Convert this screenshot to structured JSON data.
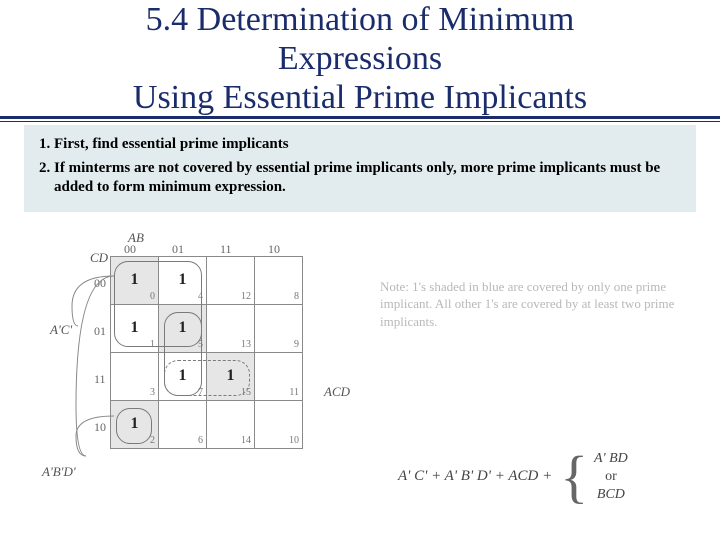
{
  "slide": {
    "title_l1": "5.4 Determination of Minimum",
    "title_l2": "Expressions",
    "title_l3": "Using Essential Prime Implicants"
  },
  "steps": {
    "s1": "First, find essential prime implicants",
    "s2": "If minterms are not covered by essential prime implicants only, more prime implicants must be added to form minimum expression."
  },
  "kmap": {
    "var_cols": "AB",
    "var_rows": "CD",
    "col_headers": [
      "00",
      "01",
      "11",
      "10"
    ],
    "row_headers": [
      "00",
      "01",
      "11",
      "10"
    ],
    "cells": [
      [
        {
          "v": "1",
          "n": "0"
        },
        {
          "v": "1",
          "n": "4"
        },
        {
          "v": "",
          "n": "12"
        },
        {
          "v": "",
          "n": "8"
        }
      ],
      [
        {
          "v": "1",
          "n": "1"
        },
        {
          "v": "1",
          "n": "5"
        },
        {
          "v": "",
          "n": "13"
        },
        {
          "v": "",
          "n": "9"
        }
      ],
      [
        {
          "v": "",
          "n": "3"
        },
        {
          "v": "1",
          "n": "7"
        },
        {
          "v": "1",
          "n": "15"
        },
        {
          "v": "",
          "n": "11"
        }
      ],
      [
        {
          "v": "1",
          "n": "2"
        },
        {
          "v": "",
          "n": "6"
        },
        {
          "v": "",
          "n": "14"
        },
        {
          "v": "",
          "n": "10"
        }
      ]
    ],
    "side_labels": {
      "ac_prime": "A'C'",
      "ab_d_prime": "A'B'D'",
      "acd": "ACD"
    }
  },
  "note": "Note: 1's shaded in blue are covered by only one prime implicant. All other 1's are covered by at least two prime implicants.",
  "expression": {
    "left": "A' C' + A' B' D' + ACD +",
    "opt1": "A' BD",
    "or": "or",
    "opt2": "BCD"
  }
}
